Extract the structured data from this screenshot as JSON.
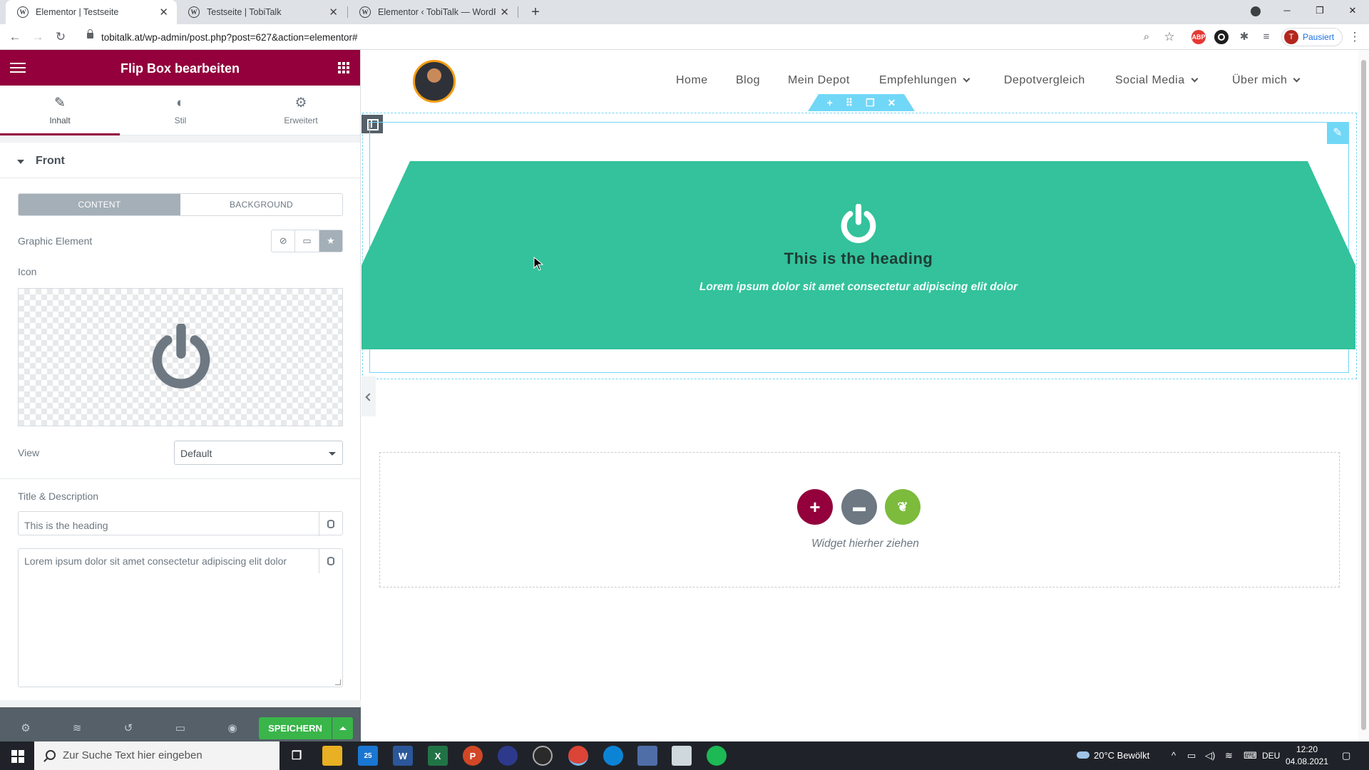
{
  "browser": {
    "tabs": [
      {
        "title": "Elementor | Testseite",
        "active": true
      },
      {
        "title": "Testseite | TobiTalk",
        "active": false
      },
      {
        "title": "Elementor ‹ TobiTalk — WordPre",
        "active": false
      }
    ],
    "url": "tobitalk.at/wp-admin/post.php?post=627&action=elementor#",
    "profile_initial": "T",
    "profile_status": "Pausiert",
    "ext_abp": "ABP"
  },
  "panel": {
    "title": "Flip Box bearbeiten",
    "tabs": [
      {
        "label": "Inhalt",
        "icon": "pencil-icon"
      },
      {
        "label": "Stil",
        "icon": "contrast-icon"
      },
      {
        "label": "Erweitert",
        "icon": "gear-icon"
      }
    ],
    "section_title": "Front",
    "content_tab": "CONTENT",
    "background_tab": "BACKGROUND",
    "graphic_element_label": "Graphic Element",
    "icon_label": "Icon",
    "view_label": "View",
    "view_value": "Default",
    "title_desc_label": "Title & Description",
    "title_value": "This is the heading",
    "description_value": "Lorem ipsum dolor sit amet consectetur adipiscing elit dolor",
    "save_label": "SPEICHERN",
    "accent_color": "#93003c"
  },
  "site": {
    "nav": [
      "Home",
      "Blog",
      "Mein Depot",
      "Empfehlungen",
      "Depotvergleich",
      "Social Media",
      "Über mich"
    ],
    "flipbox": {
      "heading": "This is the heading",
      "description": "Lorem ipsum dolor sit amet consectetur adipiscing elit dolor",
      "icon": "power-icon",
      "color": "#33c29b"
    },
    "drop_text": "Widget hierher ziehen"
  },
  "taskbar": {
    "search_placeholder": "Zur Suche Text hier eingeben",
    "weather": "20°C  Bewölkt",
    "language": "DEU",
    "time": "12:20",
    "date": "04.08.2021",
    "mail_badge": "25"
  }
}
